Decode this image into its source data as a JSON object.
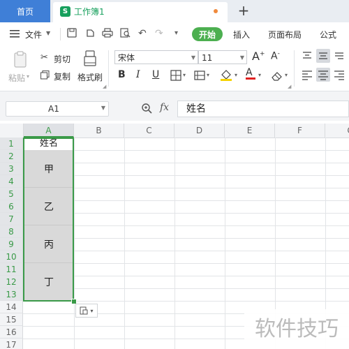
{
  "tabs": {
    "home": "首页",
    "workbook_logo": "S",
    "workbook": "工作簿1",
    "new_tab": "+"
  },
  "menu": {
    "file": "文件",
    "start": "开始",
    "insert": "插入",
    "page_layout": "页面布局",
    "formula": "公式"
  },
  "ribbon": {
    "paste": "粘贴",
    "cut": "剪切",
    "copy": "复制",
    "format_painter": "格式刷",
    "font_name": "宋体",
    "font_size": "11",
    "bold": "B",
    "italic": "I",
    "underline": "U",
    "font_color_letter": "A"
  },
  "formula_bar": {
    "cell_ref": "A1",
    "fx": "fx",
    "value": "姓名"
  },
  "sheet": {
    "columns": [
      "A",
      "B",
      "C",
      "D",
      "E",
      "F",
      "G"
    ],
    "rows": [
      "1",
      "2",
      "3",
      "4",
      "5",
      "6",
      "7",
      "8",
      "9",
      "10",
      "11",
      "12",
      "13",
      "14",
      "15",
      "16",
      "17"
    ],
    "header_cell": "姓名",
    "merged_cells": [
      "甲",
      "乙",
      "丙",
      "丁"
    ]
  },
  "watermark": "软件技巧",
  "colors": {
    "accent_green": "#4caf50",
    "selection_green": "#3a9a48",
    "home_tab_blue": "#3f7fd7",
    "merged_fill": "#d9d9d9"
  }
}
